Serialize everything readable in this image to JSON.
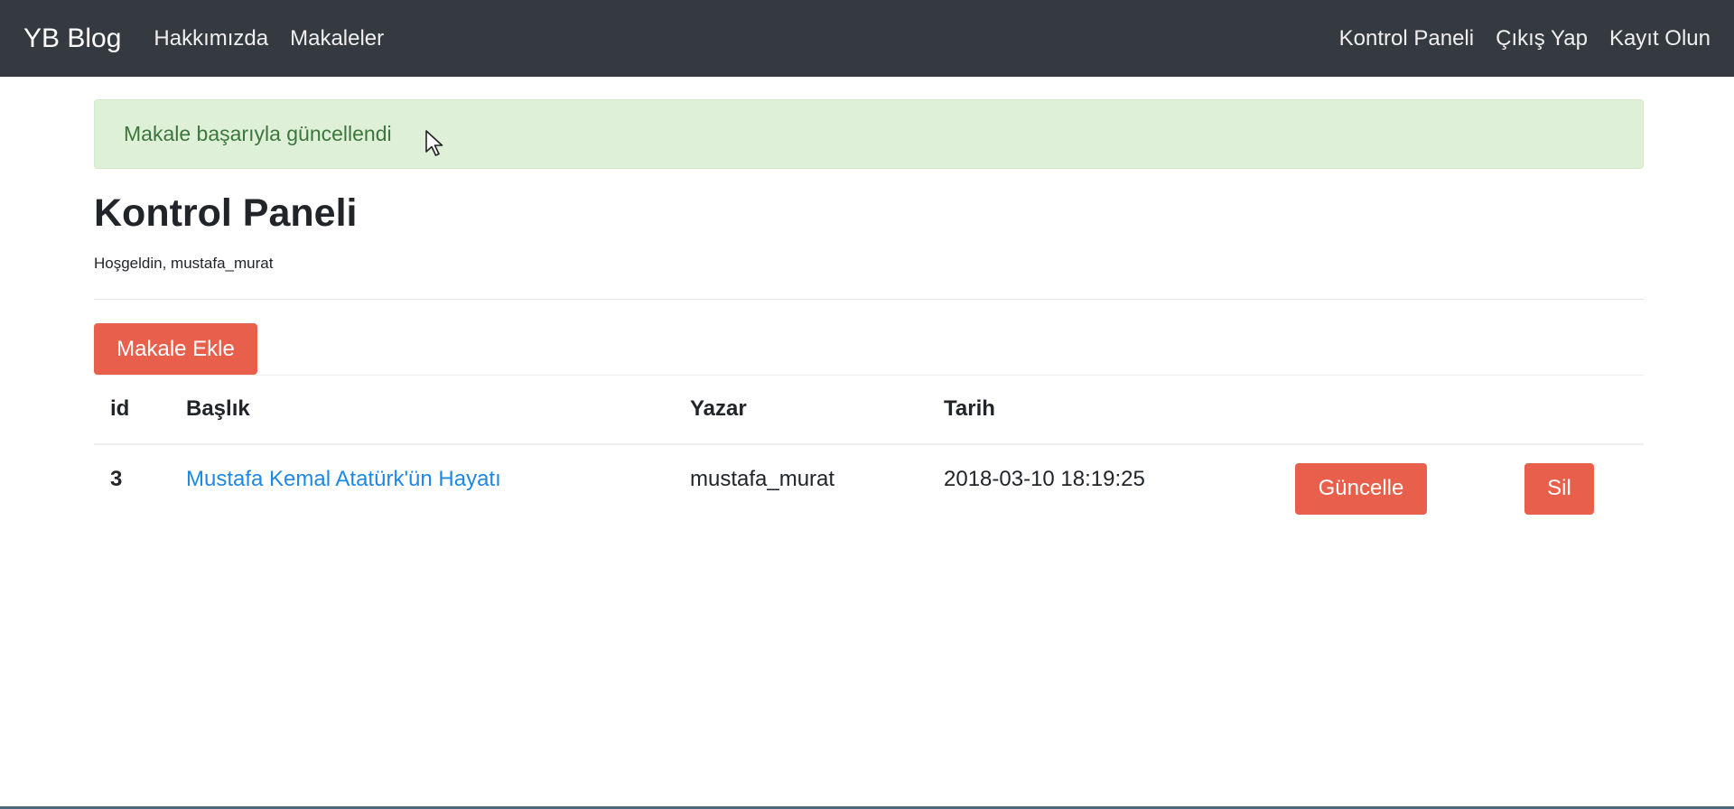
{
  "navbar": {
    "brand": "YB Blog",
    "left_links": [
      "Hakkımızda",
      "Makaleler"
    ],
    "right_links": [
      "Kontrol Paneli",
      "Çıkış Yap",
      "Kayıt Olun"
    ],
    "background_color": "#343a40"
  },
  "alert": {
    "message": "Makale başarıyla güncellendi",
    "background_color": "#dff0d8",
    "text_color": "#3c763d"
  },
  "dashboard": {
    "title": "Kontrol Paneli",
    "welcome": "Hoşgeldin, mustafa_murat",
    "add_button_label": "Makale Ekle"
  },
  "table": {
    "headers": [
      "id",
      "Başlık",
      "Yazar",
      "Tarih"
    ],
    "rows": [
      {
        "id": "3",
        "title": "Mustafa Kemal Atatürk'ün Hayatı",
        "author": "mustafa_murat",
        "date": "2018-03-10 18:19:25",
        "edit_label": "Güncelle",
        "delete_label": "Sil"
      }
    ]
  },
  "colors": {
    "accent_button": "#e8604c",
    "link": "#1e88e5"
  }
}
